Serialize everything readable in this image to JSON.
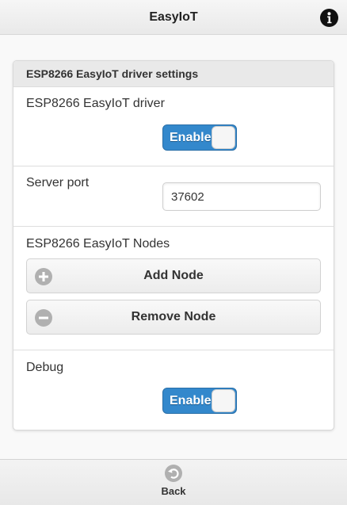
{
  "header": {
    "title": "EasyIoT",
    "info_icon": "info-icon"
  },
  "panel": {
    "title": "ESP8266 EasyIoT driver settings",
    "driver": {
      "label": "ESP8266 EasyIoT driver",
      "toggle_label": "Enable",
      "enabled": true
    },
    "server_port": {
      "label": "Server port",
      "value": "37602"
    },
    "nodes": {
      "label": "ESP8266 EasyIoT Nodes",
      "add_label": "Add Node",
      "remove_label": "Remove Node"
    },
    "debug": {
      "label": "Debug",
      "toggle_label": "Enable",
      "enabled": true
    }
  },
  "footer": {
    "back_label": "Back"
  },
  "colors": {
    "accent": "#3388cc",
    "icon_gray": "#b0b0b0"
  }
}
